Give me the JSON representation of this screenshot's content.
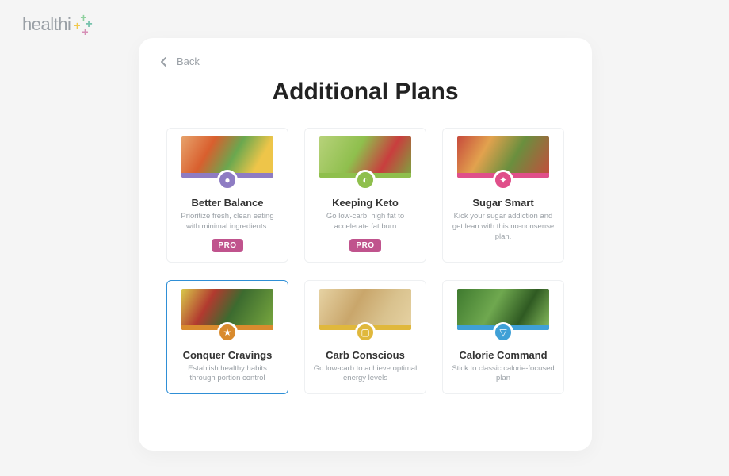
{
  "brand": {
    "name": "healthi"
  },
  "nav": {
    "back_label": "Back"
  },
  "page": {
    "title": "Additional Plans"
  },
  "badges": {
    "pro": "PRO"
  },
  "plans": [
    {
      "title": "Better Balance",
      "desc": "Prioritize fresh, clean eating with minimal ingredients.",
      "pro": true,
      "accent": "purple",
      "icon": "apple-icon",
      "selected": false
    },
    {
      "title": "Keeping Keto",
      "desc": "Go low-carb, high fat to accelerate fat burn",
      "pro": true,
      "accent": "green",
      "icon": "avocado-icon",
      "selected": false
    },
    {
      "title": "Sugar Smart",
      "desc": "Kick your sugar addiction and get lean with this no-nonsense plan.",
      "pro": false,
      "accent": "pink",
      "icon": "lightbulb-icon",
      "selected": false
    },
    {
      "title": "Conquer Cravings",
      "desc": "Establish healthy habits through portion control",
      "pro": false,
      "accent": "orange",
      "icon": "star-icon",
      "selected": true
    },
    {
      "title": "Carb Conscious",
      "desc": "Go low-carb to achieve optimal energy levels",
      "pro": false,
      "accent": "yellow",
      "icon": "bread-icon",
      "selected": false
    },
    {
      "title": "Calorie Command",
      "desc": "Stick to classic calorie-focused plan",
      "pro": false,
      "accent": "blue",
      "icon": "drop-icon",
      "selected": false
    }
  ]
}
